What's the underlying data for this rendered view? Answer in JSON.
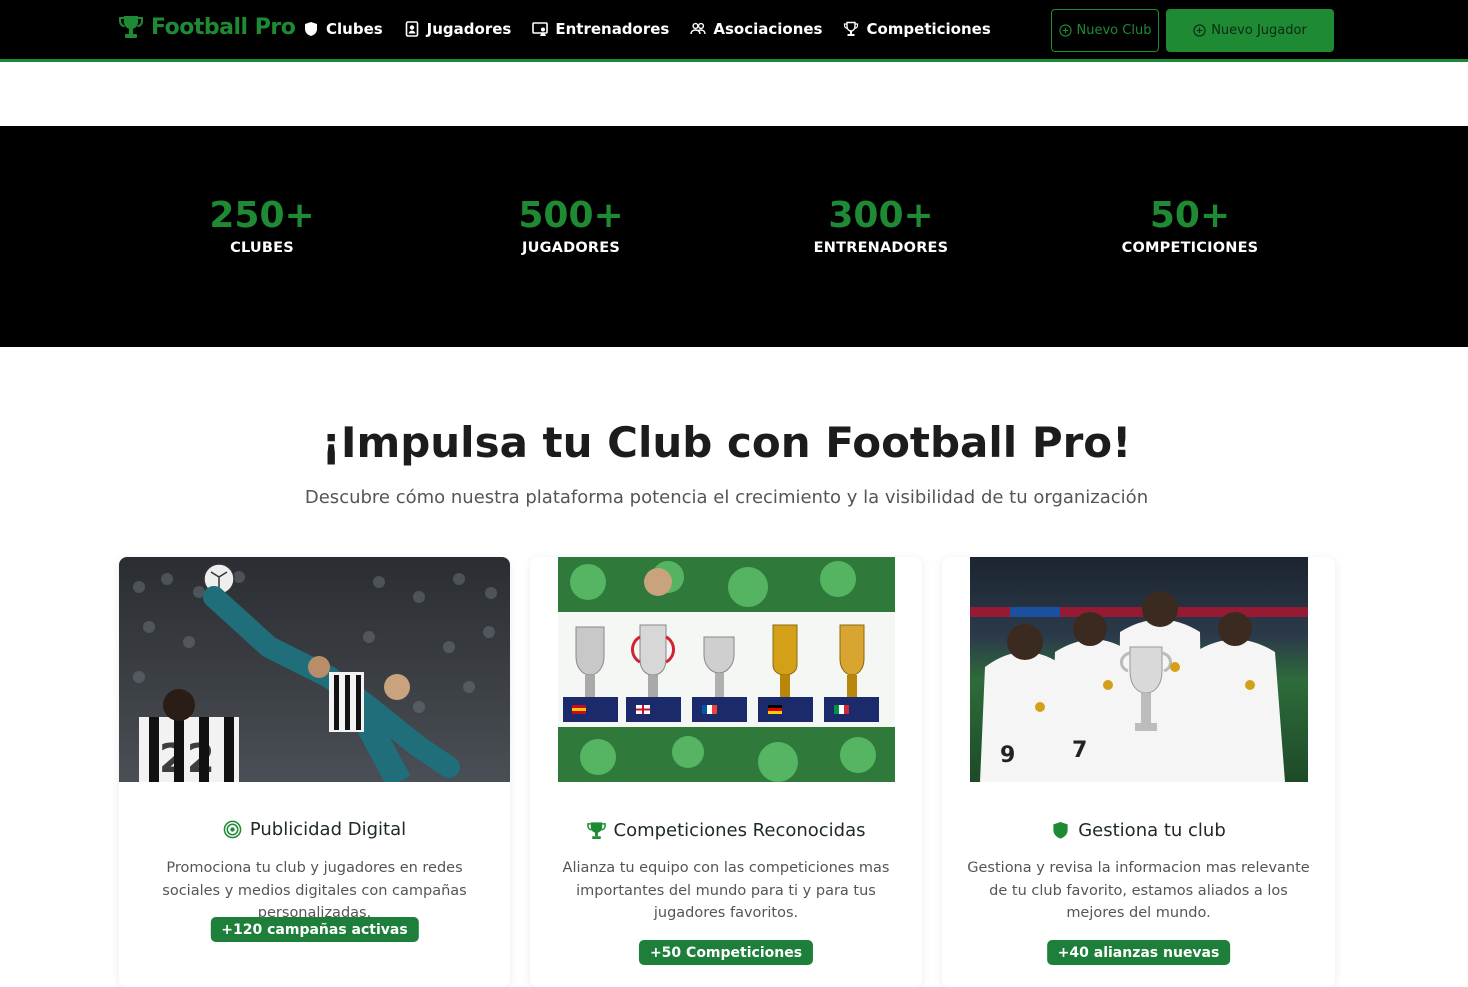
{
  "brand": {
    "name": "Football Pro",
    "icon": "trophy-icon",
    "color": "#1e8b34"
  },
  "nav": {
    "items": [
      {
        "label": "Clubes",
        "icon": "shield-icon"
      },
      {
        "label": "Jugadores",
        "icon": "id-badge-icon"
      },
      {
        "label": "Entrenadores",
        "icon": "person-screen-icon"
      },
      {
        "label": "Asociaciones",
        "icon": "people-icon"
      },
      {
        "label": "Competiciones",
        "icon": "trophy-outline-icon"
      }
    ],
    "new_club_label": "Nuevo Club",
    "new_player_label": "Nuevo Jugador"
  },
  "stats": [
    {
      "value": "250+",
      "label": "CLUBES"
    },
    {
      "value": "500+",
      "label": "JUGADORES"
    },
    {
      "value": "300+",
      "label": "ENTRENADORES"
    },
    {
      "value": "50+",
      "label": "COMPETICIONES"
    }
  ],
  "promo": {
    "title": "¡Impulsa tu Club con Football Pro!",
    "subtitle": "Descubre cómo nuestra plataforma potencia el crecimiento y la visibilidad de tu organización"
  },
  "cards": [
    {
      "title": "Publicidad Digital",
      "icon": "target-icon",
      "text": "Promociona tu club y jugadores en redes sociales y medios digitales con campañas personalizadas.",
      "badge": "+120 campañas activas",
      "image": "bicycle-kick-photo"
    },
    {
      "title": "Competiciones Reconocidas",
      "icon": "trophy-icon",
      "text": "Alianza tu equipo con las competiciones mas importantes del mundo para ti y para tus jugadores favoritos.",
      "badge": "+50 Competiciones",
      "image": "trophies-collage"
    },
    {
      "title": "Gestiona tu club",
      "icon": "shield-icon",
      "text": "Gestiona y revisa la informacion mas relevante de tu club favorito, estamos aliados a los mejores del mundo.",
      "badge": "+40 alianzas nuevas",
      "image": "team-celebration-photo"
    }
  ],
  "colors": {
    "accent": "#1e8b34",
    "badge": "#1e7f3a",
    "dark": "#000000"
  }
}
